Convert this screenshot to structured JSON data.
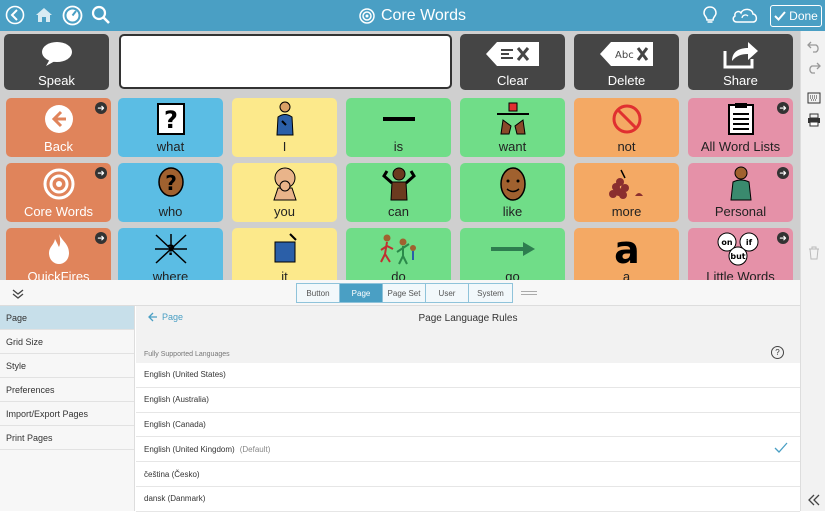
{
  "header": {
    "title": "Core Words"
  },
  "toolbar": {
    "speak": "Speak",
    "clear": "Clear",
    "delete": "Delete",
    "share": "Share",
    "done": "Done",
    "message": ""
  },
  "grid": {
    "nav": [
      "Back",
      "Core Words",
      "QuickFires"
    ],
    "rows": [
      [
        "what",
        "I",
        "is",
        "want",
        "not",
        "All Word Lists"
      ],
      [
        "who",
        "you",
        "can",
        "like",
        "more",
        "Personal"
      ],
      [
        "where",
        "it",
        "do",
        "go",
        "a",
        "Little Words"
      ]
    ],
    "little_words_symbol": [
      "on",
      "if",
      "but"
    ]
  },
  "colors": {
    "top": "#4a9fc4",
    "nav": "#e0845b",
    "blue": "#5bbde4",
    "yellow": "#fce98b",
    "green": "#70dd88",
    "orange": "#f4a964",
    "pink": "#e591a8",
    "dark": "#454545"
  },
  "editor": {
    "tabs": [
      "Button",
      "Page",
      "Page Set",
      "User",
      "System"
    ],
    "active_tab": "Page",
    "sidebar": [
      "Page",
      "Grid Size",
      "Style",
      "Preferences",
      "Import/Export Pages",
      "Print Pages"
    ],
    "back": "Page",
    "title": "Page Language Rules",
    "section": "Fully Supported Languages",
    "help": "?",
    "languages": [
      {
        "name": "English (United States)",
        "note": ""
      },
      {
        "name": "English (Australia)",
        "note": ""
      },
      {
        "name": "English (Canada)",
        "note": ""
      },
      {
        "name": "English (United Kingdom)",
        "note": "(Default)"
      },
      {
        "name": "čeština (Česko)",
        "note": ""
      },
      {
        "name": "dansk (Danmark)",
        "note": ""
      }
    ]
  }
}
